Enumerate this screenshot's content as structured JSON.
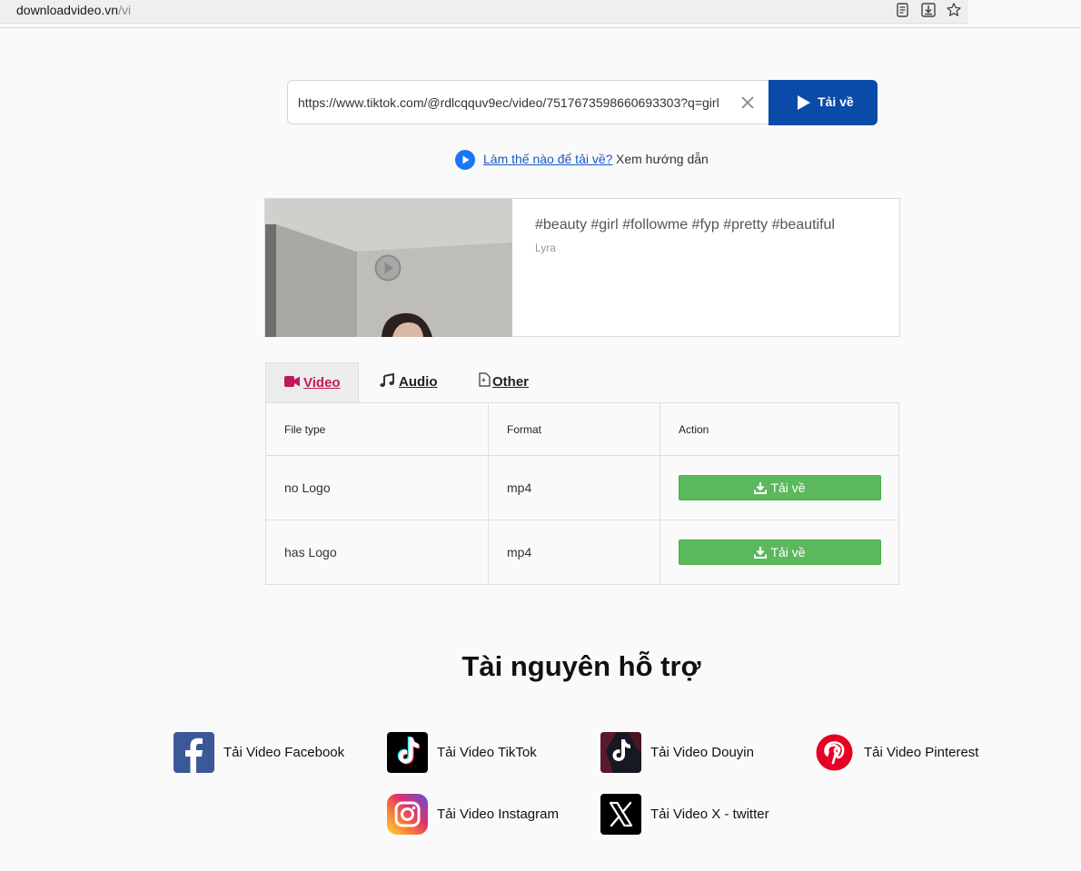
{
  "browser": {
    "domain": "downloadvideo.vn",
    "path": "/vi"
  },
  "search": {
    "value": "https://www.tiktok.com/@rdlcqquv9ec/video/7517673598660693303?q=girl",
    "button_label": "Tải về"
  },
  "howto": {
    "link": "Làm thế nào để tải về?",
    "guide": "Xem hướng dẫn"
  },
  "video": {
    "caption": "#beauty #girl #followme #fyp #pretty #beautiful",
    "author": "Lyra"
  },
  "tabs": [
    {
      "label": "Video",
      "icon": "video-camera-icon",
      "active": true
    },
    {
      "label": "Audio",
      "icon": "music-note-icon",
      "active": false
    },
    {
      "label": "Other",
      "icon": "file-icon",
      "active": false
    }
  ],
  "table": {
    "headers": [
      "File type",
      "Format",
      "Action"
    ],
    "rows": [
      {
        "file_type": "no Logo",
        "format": "mp4",
        "action": "Tải về"
      },
      {
        "file_type": "has Logo",
        "format": "mp4",
        "action": "Tải về"
      }
    ]
  },
  "resources": {
    "title": "Tài nguyên hỗ trợ",
    "items": [
      {
        "label": "Tải Video Facebook",
        "icon": "facebook-icon"
      },
      {
        "label": "Tải Video TikTok",
        "icon": "tiktok-icon"
      },
      {
        "label": "Tải Video Douyin",
        "icon": "douyin-icon"
      },
      {
        "label": "Tải Video Pinterest",
        "icon": "pinterest-icon"
      },
      {
        "label": "Tải Video Instagram",
        "icon": "instagram-icon"
      },
      {
        "label": "Tải Video X - twitter",
        "icon": "x-twitter-icon"
      }
    ]
  },
  "colors": {
    "primary_button": "#0a4aa8",
    "download_button": "#5cb85c",
    "active_tab": "#c2185b",
    "link": "#1a57c8"
  }
}
